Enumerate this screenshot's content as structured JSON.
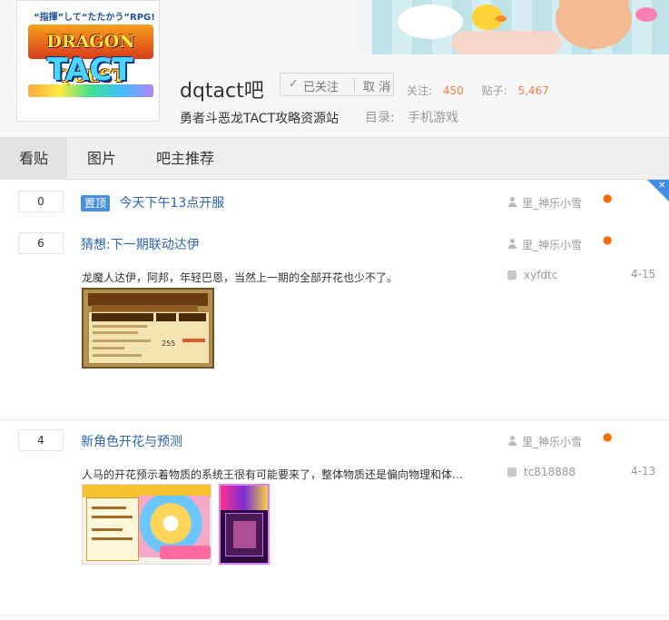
{
  "header": {
    "forum_name": "dqtact吧",
    "followed_label": "已关注",
    "cancel_label": "取 消",
    "followers_label": "关注:",
    "followers_count": "450",
    "posts_label": "贴子:",
    "posts_count": "5,467",
    "subtitle": "勇者斗恶龙TACT攻略资源站",
    "catalog_label": "目录:",
    "catalog_value": "手机游戏",
    "logo": {
      "tagline": "“指揮”して“たたかう”RPG!",
      "brand": "DRAGON QUEST",
      "sub": "TACT"
    }
  },
  "tabs": [
    "看贴",
    "图片",
    "吧主推荐"
  ],
  "threads": [
    {
      "reply_count": "0",
      "pinned_label": "置顶",
      "title": "今天下午13点开服",
      "author": "里_神乐小雪"
    },
    {
      "reply_count": "6",
      "title": "猜想:下一期联动达伊",
      "author": "里_神乐小雪",
      "excerpt": "龙魔人达伊，阿邦，年轻巴恩，当然上一期的全部开花也少不了。",
      "last_replier": "xyfdtc",
      "date": "4-15"
    },
    {
      "reply_count": "4",
      "title": "新角色开花与预测",
      "author": "里_神乐小雪",
      "excerpt": "人马的开花预示着物质的系统王很有可能要来了，整体物质还是偏向物理和体…",
      "last_replier": "tc818888",
      "date": "4-13"
    }
  ],
  "image_a": {
    "cell_value": "255"
  }
}
